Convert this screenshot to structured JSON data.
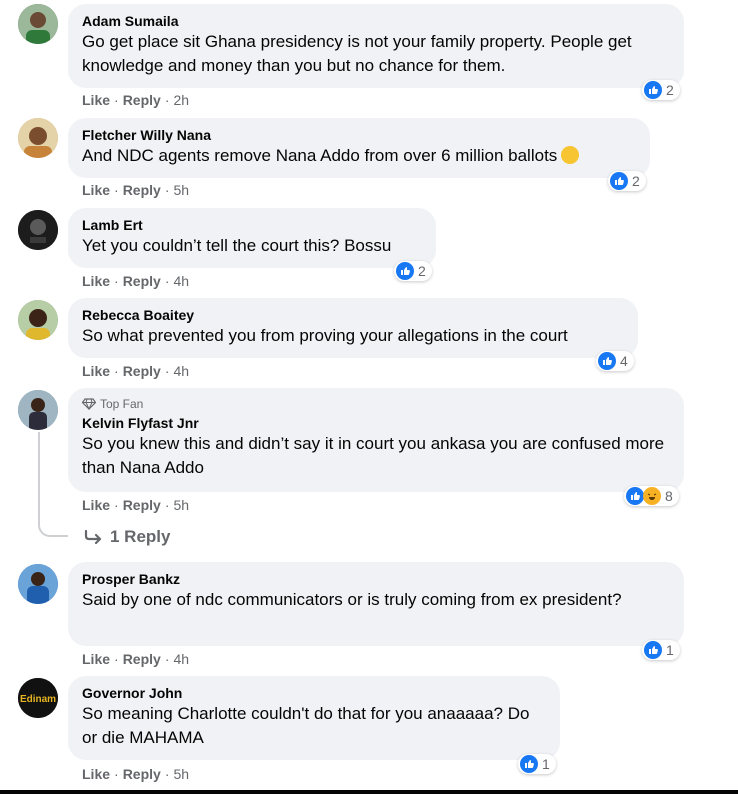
{
  "actions": {
    "like": "Like",
    "reply": "Reply",
    "sep": "·"
  },
  "colors": {
    "bubble": "#f0f2f5",
    "like_blue": "#1877f2",
    "meta_gray": "#65676b",
    "haha_yellow": "#f7b125"
  },
  "comments": [
    {
      "author": "Adam Sumaila",
      "text": "Go get place sit Ghana presidency is not your family property. People get knowledge and money than you but no chance for them.",
      "time": "2h",
      "reactions": [
        "like"
      ],
      "count": "2",
      "avatar_color": "#3a6b3e"
    },
    {
      "author": "Fletcher Willy Nana",
      "text": "And NDC agents remove Nana Addo from over 6 million ballots",
      "emoji": "thinking-face",
      "time": "5h",
      "reactions": [
        "like"
      ],
      "count": "2",
      "avatar_color": "#c79a4a"
    },
    {
      "author": "Lamb Ert",
      "text": "Yet you couldn’t tell the court this? Bossu",
      "time": "4h",
      "reactions": [
        "like"
      ],
      "count": "2",
      "avatar_color": "#1c1c1c"
    },
    {
      "author": "Rebecca Boaitey",
      "text": "So what prevented you from proving your allegations in the court",
      "time": "4h",
      "reactions": [
        "like"
      ],
      "count": "4",
      "avatar_color": "#8fae7a"
    },
    {
      "badge": "Top Fan",
      "author": "Kelvin Flyfast Jnr",
      "text": "So you knew this and didn’t say it in court you ankasa you are confused more than Nana Addo",
      "time": "5h",
      "reactions": [
        "like",
        "haha"
      ],
      "count": "8",
      "avatar_color": "#5f7f9a"
    },
    {
      "author": "Prosper Bankz",
      "text": "Said by one of ndc communicators or is truly coming from ex president?",
      "time": "4h",
      "reactions": [
        "like"
      ],
      "count": "1",
      "avatar_color": "#2d6fb8"
    },
    {
      "author": "Governor John",
      "text": "So meaning Charlotte couldn't do that for you anaaaaa? Do or die MAHAMA",
      "time": "5h",
      "reactions": [
        "like"
      ],
      "count": "1",
      "avatar_color": "#111111",
      "avatar_text": "Edinam"
    }
  ],
  "replies_link": "1 Reply"
}
